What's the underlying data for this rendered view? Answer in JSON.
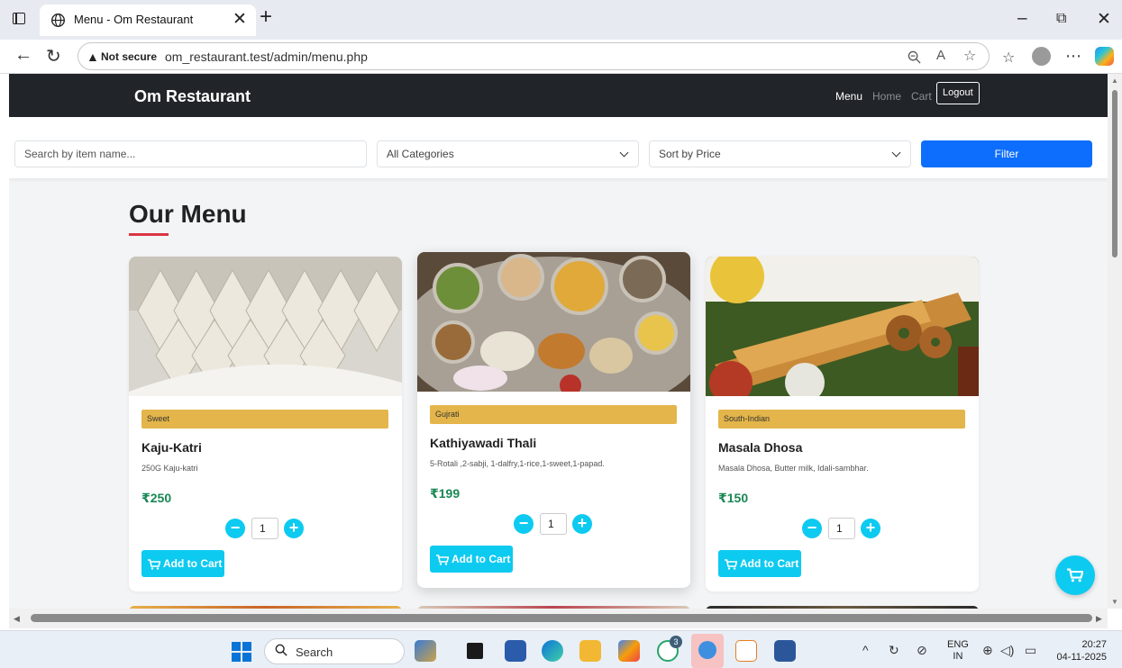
{
  "browser": {
    "tab_title": "Menu - Om Restaurant",
    "new_tab_symbol": "+",
    "security_label": "Not secure",
    "url": "om_restaurant.test/admin/menu.php",
    "min_symbol": "–",
    "max_symbol": "⧉",
    "close_symbol": "✕"
  },
  "site": {
    "brand": "Om Restaurant",
    "nav": [
      {
        "label": "Menu",
        "active": true
      },
      {
        "label": "Home",
        "active": false
      },
      {
        "label": "Cart",
        "active": false
      }
    ],
    "logout_label": "Logout"
  },
  "filters": {
    "search_placeholder": "Search by item name...",
    "category_value": "All Categories",
    "sort_value": "Sort by Price",
    "filter_label": "Filter"
  },
  "menu": {
    "heading": "Our Menu",
    "add_label": "Add to Cart",
    "items": [
      {
        "category": "Sweet",
        "name": "Kaju-Katri",
        "description": "250G Kaju-katri",
        "price": "₹250",
        "qty": "1"
      },
      {
        "category": "Gujrati",
        "name": "Kathiyawadi Thali",
        "description": "5-Rotali ,2-sabji, 1-dalfry,1-rice,1-sweet,1-papad.",
        "price": "₹199",
        "qty": "1"
      },
      {
        "category": "South-Indian",
        "name": "Masala Dhosa",
        "description": "Masala Dhosa, Butter milk, Idali-sambhar.",
        "price": "₹150",
        "qty": "1"
      }
    ]
  },
  "taskbar": {
    "search_label": "Search",
    "lang_line1": "ENG",
    "lang_line2": "IN",
    "time": "20:27",
    "date": "04-11-2025",
    "whatsapp_badge": "3"
  },
  "colors": {
    "navbar": "#212529",
    "primary": "#0d6efd",
    "info": "#0dcaf0",
    "badge": "#e3b54a",
    "price": "#198754",
    "accent": "#dc3545"
  }
}
